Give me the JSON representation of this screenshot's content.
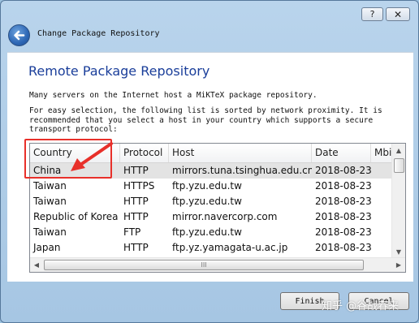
{
  "titlebar": {
    "help_glyph": "?",
    "close_glyph": "✕"
  },
  "wizard": {
    "back_icon": "back-arrow-icon",
    "title": "Change Package Repository"
  },
  "page": {
    "heading": "Remote Package Repository",
    "paragraph1": "Many servers on the Internet host a MiKTeX package repository.",
    "paragraph2_line1": "For easy selection, the following list is sorted by network proximity. It is",
    "paragraph2_line2": "recommended that you select a host in your country which supports a secure",
    "paragraph2_line3": "transport protocol:"
  },
  "table": {
    "columns": [
      "Country",
      "Protocol",
      "Host",
      "Date",
      "Mbi"
    ],
    "rows": [
      {
        "country": "China",
        "protocol": "HTTP",
        "host": "mirrors.tuna.tsinghua.edu.cn",
        "date": "2018-08-23"
      },
      {
        "country": "Taiwan",
        "protocol": "HTTPS",
        "host": "ftp.yzu.edu.tw",
        "date": "2018-08-23"
      },
      {
        "country": "Taiwan",
        "protocol": "HTTP",
        "host": "ftp.yzu.edu.tw",
        "date": "2018-08-23"
      },
      {
        "country": "Republic of Korea",
        "protocol": "HTTP",
        "host": "mirror.navercorp.com",
        "date": "2018-08-23"
      },
      {
        "country": "Taiwan",
        "protocol": "FTP",
        "host": "ftp.yzu.edu.tw",
        "date": "2018-08-23"
      },
      {
        "country": "Japan",
        "protocol": "HTTP",
        "host": "ftp.yz.yamagata-u.ac.jp",
        "date": "2018-08-23"
      }
    ],
    "selected_row": 0,
    "scroll_up_glyph": "▲",
    "scroll_down_glyph": "▼",
    "scroll_left_glyph": "◀",
    "scroll_right_glyph": "▶",
    "thumb_grip": "III"
  },
  "buttons": {
    "finish": "Finish",
    "cancel": "Cancel"
  },
  "watermark": "知乎 @谷战春来",
  "colors": {
    "heading": "#1a3e9a",
    "annotation": "#e8302a",
    "selection": "#e3e3e3"
  }
}
